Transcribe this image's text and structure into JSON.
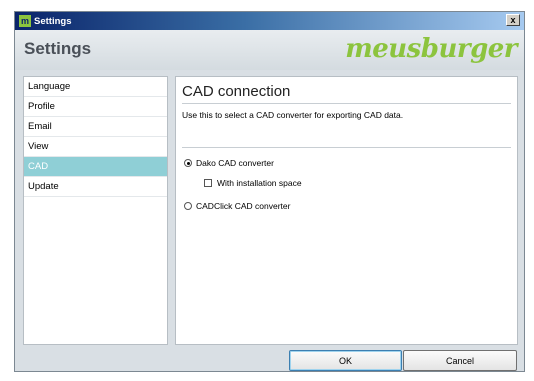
{
  "window": {
    "title": "Settings",
    "app_icon_glyph": "m",
    "close_glyph": "x"
  },
  "header": {
    "title": "Settings",
    "logo_text": "meusburger",
    "logo_color": "#8cc43e"
  },
  "sidebar": {
    "items": [
      {
        "label": "Language",
        "selected": false
      },
      {
        "label": "Profile",
        "selected": false
      },
      {
        "label": "Email",
        "selected": false
      },
      {
        "label": "View",
        "selected": false
      },
      {
        "label": "CAD",
        "selected": true
      },
      {
        "label": "Update",
        "selected": false
      }
    ],
    "selected_color": "#8fcfd6"
  },
  "content": {
    "heading": "CAD connection",
    "description": "Use this to select a CAD converter for exporting CAD data.",
    "options": {
      "dako_label": "Dako CAD converter",
      "dako_selected": true,
      "install_space_label": "With installation space",
      "install_space_checked": false,
      "cadclick_label": "CADClick CAD converter",
      "cadclick_selected": false
    }
  },
  "buttons": {
    "ok_label": "OK",
    "cancel_label": "Cancel"
  }
}
